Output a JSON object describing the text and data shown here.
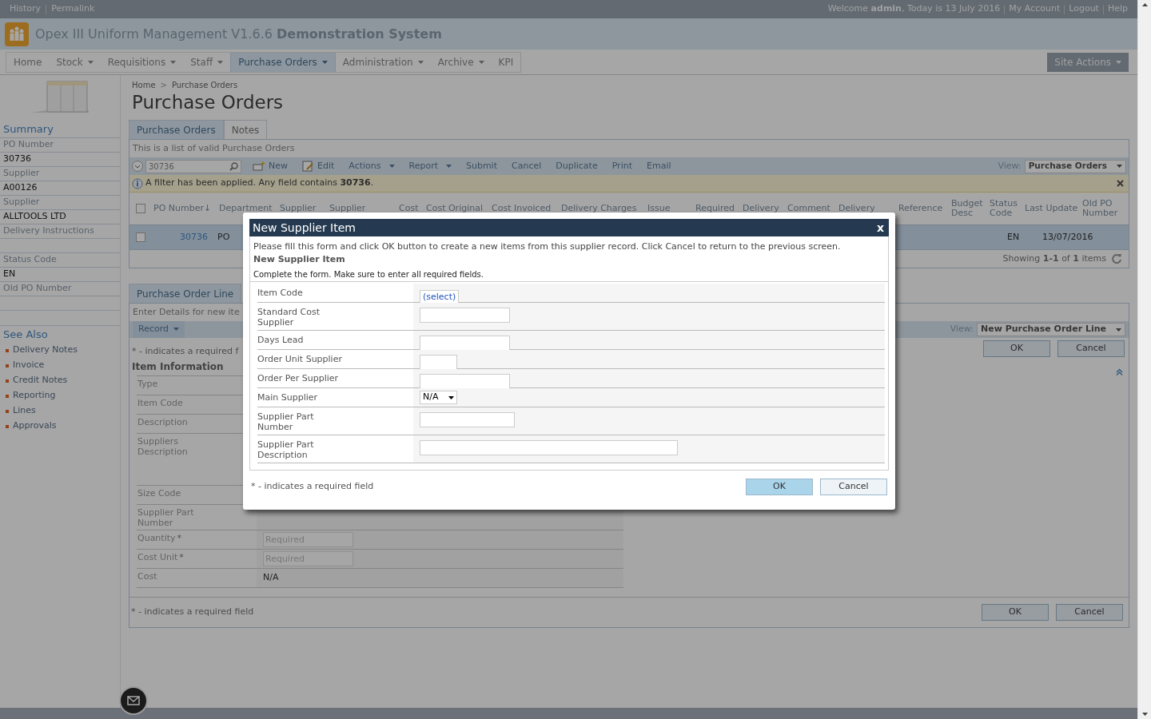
{
  "top_bar": {
    "links": [
      "History",
      "Permalink"
    ],
    "welcome": "Welcome **admin**, Today is 13 July 2016",
    "account_links": [
      "My Account",
      "Logout",
      "Help"
    ]
  },
  "app_title": "Opex III Uniform Management V1.6.6 **Demonstration System**",
  "nav": {
    "items": [
      {
        "label": "Home",
        "dropdown": false,
        "selected": false
      },
      {
        "label": "Stock",
        "dropdown": true,
        "selected": false
      },
      {
        "label": "Requisitions",
        "dropdown": true,
        "selected": false
      },
      {
        "label": "Staff",
        "dropdown": true,
        "selected": false
      },
      {
        "label": "Purchase Orders",
        "dropdown": true,
        "selected": true
      },
      {
        "label": "Administration",
        "dropdown": true,
        "selected": false
      },
      {
        "label": "Archive",
        "dropdown": true,
        "selected": false
      },
      {
        "label": "KPI",
        "dropdown": false,
        "selected": false
      }
    ],
    "site_actions": "Site Actions"
  },
  "breadcrumb": [
    "Home",
    "Purchase Orders"
  ],
  "breadcrumb_separator": ">",
  "page_title": "Purchase Orders",
  "summary": {
    "title": "Summary",
    "rows": [
      {
        "kind": "label",
        "text": "PO Number"
      },
      {
        "kind": "value",
        "text": "30736"
      },
      {
        "kind": "label",
        "text": "Supplier"
      },
      {
        "kind": "value",
        "text": "A00126"
      },
      {
        "kind": "label",
        "text": "Supplier"
      },
      {
        "kind": "value",
        "text": "ALLTOOLS LTD"
      },
      {
        "kind": "label",
        "text": "Delivery Instructions"
      },
      {
        "kind": "blank"
      },
      {
        "kind": "label",
        "text": "Status Code"
      },
      {
        "kind": "value",
        "text": "EN"
      },
      {
        "kind": "label",
        "text": "Old PO Number"
      },
      {
        "kind": "blank"
      }
    ]
  },
  "see_also": {
    "title": "See Also",
    "links": [
      "Delivery Notes",
      "Invoice",
      "Credit Notes",
      "Reporting",
      "Lines",
      "Approvals"
    ]
  },
  "po_tabs": [
    {
      "label": "Purchase Orders",
      "selected": true
    },
    {
      "label": "Notes",
      "selected": false
    }
  ],
  "list_caption": "This is a list of valid Purchase Orders",
  "toolbar": {
    "search_value": "30736",
    "buttons": [
      {
        "kind": "new",
        "label": "New"
      },
      {
        "kind": "edit",
        "label": "Edit"
      },
      {
        "kind": "menu",
        "label": "Actions"
      },
      {
        "kind": "menu",
        "label": "Report"
      },
      {
        "kind": "plain",
        "label": "Submit"
      },
      {
        "kind": "plain",
        "label": "Cancel"
      },
      {
        "kind": "plain",
        "label": "Duplicate"
      },
      {
        "kind": "plain",
        "label": "Print"
      },
      {
        "kind": "plain",
        "label": "Email"
      }
    ],
    "view_label": "View:",
    "view_value": "Purchase Orders"
  },
  "filter_notice": "A filter has been applied. Any field contains **30736**.",
  "table": {
    "columns": [
      "PO Number↓",
      "Department",
      "Supplier",
      "Supplier",
      "Cost",
      "Cost Original",
      "Cost Invoiced",
      "Delivery Charges",
      "Issue",
      "Required",
      "Delivery",
      "Comment",
      "Delivery",
      "Reference",
      "Budget Desc",
      "Status Code",
      "Last Update",
      "Old PO Number"
    ],
    "header_checked": false,
    "row": {
      "selected": true,
      "checked": false,
      "po_number": "30736",
      "department": "PO",
      "status_code": "EN",
      "last_update": "13/07/2016"
    },
    "footer": "Showing **1-1** of **1** items"
  },
  "line_section": {
    "tab": "Purchase Order Line",
    "caption": "Enter Details for new ite",
    "record_menu": "Record",
    "view_label": "View:",
    "view_value": "New Purchase Order Line",
    "buttons": [
      "OK",
      "Cancel"
    ],
    "required_note": "* - indicates a required f",
    "section_title": "Item Information",
    "fields": [
      {
        "label": "Type",
        "kind": "hidden"
      },
      {
        "label": "Item Code",
        "kind": "hidden"
      },
      {
        "label": "Description",
        "kind": "hidden"
      },
      {
        "label": "Suppliers\nDescription",
        "kind": "tall"
      },
      {
        "label": "Size Code",
        "kind": "hidden"
      },
      {
        "label": "Supplier Part\nNumber",
        "kind": "hidden"
      },
      {
        "label": "Quantity",
        "kind": "required",
        "mark": "*",
        "placeholder": "Required"
      },
      {
        "label": "Cost Unit",
        "kind": "required",
        "mark": "*",
        "placeholder": "Required"
      },
      {
        "label": "Cost",
        "kind": "text",
        "value": "N/A"
      }
    ],
    "bottom_note": "* - indicates a required field",
    "bottom_buttons": [
      "OK",
      "Cancel"
    ]
  },
  "modal": {
    "title": "New Supplier Item",
    "close": "x",
    "intro": "Please fill this form and click OK button to create a new items from this supplier record. Click Cancel to return to the previous screen.",
    "subtitle": "New Supplier Item",
    "instruction": "Complete the form. Make sure to enter all required fields.",
    "fields": [
      {
        "label": "Item Code",
        "kind": "select",
        "value": "(select)"
      },
      {
        "label": "Standard Cost\nSupplier",
        "kind": "input"
      },
      {
        "label": "Days Lead",
        "kind": "input"
      },
      {
        "label": "Order Unit Supplier",
        "kind": "input"
      },
      {
        "label": "Order Per Supplier",
        "kind": "input"
      },
      {
        "label": "Main Supplier",
        "kind": "dropdown",
        "value": "N/A"
      },
      {
        "label": "Supplier Part\nNumber",
        "kind": "input"
      },
      {
        "label": "Supplier Part\nDescription",
        "kind": "input"
      }
    ],
    "note": "* - indicates a required field",
    "buttons": [
      {
        "label": "OK",
        "primary": true
      },
      {
        "label": "Cancel",
        "primary": false
      }
    ]
  }
}
